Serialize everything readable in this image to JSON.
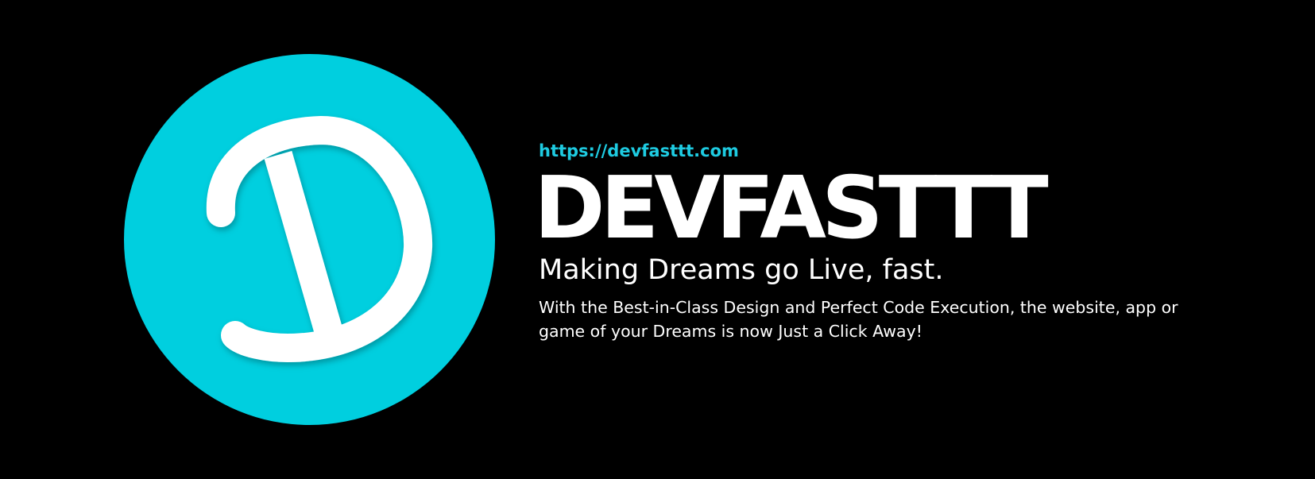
{
  "brand": {
    "url": "https://devfasttt.com",
    "name": "DEVFASTTT",
    "tagline": "Making Dreams go Live, fast.",
    "description": "With the Best-in-Class Design and Perfect Code Execution, the website, app or game of your Dreams is now Just a Click Away!"
  },
  "logo": {
    "icon": "letter-d-logo",
    "letter": "D"
  },
  "colors": {
    "background": "#000000",
    "accent": "#00cfdf",
    "url_text": "#1ecbe1",
    "text": "#ffffff"
  }
}
